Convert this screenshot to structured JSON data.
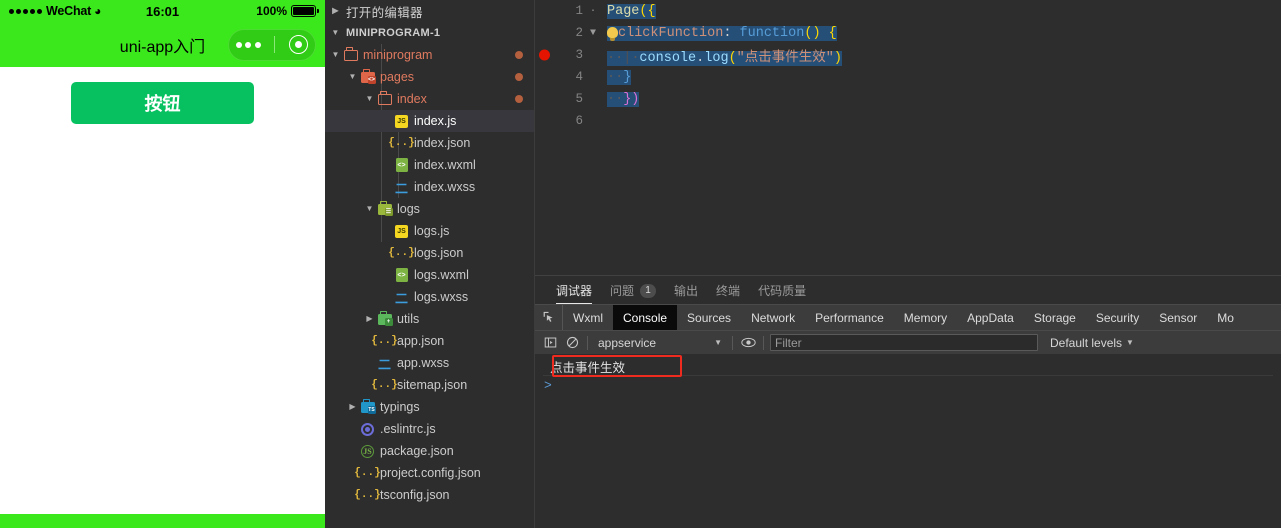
{
  "simulator": {
    "status_bar": {
      "carrier": "WeChat",
      "wifi_icon": "wifi-icon",
      "time": "16:01",
      "battery_percent": "100%",
      "battery_icon": "battery-full-icon"
    },
    "nav_title": "uni-app入门",
    "capsule": {
      "more_icon": "more-dots-icon",
      "target_icon": "target-circle-icon"
    },
    "button_label": "按钮",
    "colors": {
      "status_green": "#3ae81b",
      "button_green": "#07c160"
    }
  },
  "explorer": {
    "open_editors_label": "打开的编辑器",
    "project_label": "MINIPROGRAM-1",
    "items": [
      {
        "label": "miniprogram",
        "icon": "folder-icon",
        "depth": 1,
        "type": "folder",
        "expanded": true,
        "modified": true,
        "selected": false
      },
      {
        "label": "pages",
        "icon": "folder-pages-icon",
        "depth": 2,
        "type": "folder",
        "expanded": true,
        "modified": true,
        "selected": false
      },
      {
        "label": "index",
        "icon": "folder-icon",
        "depth": 3,
        "type": "folder",
        "expanded": true,
        "modified": true,
        "selected": false
      },
      {
        "label": "index.js",
        "icon": "js-file-icon",
        "depth": 4,
        "type": "file",
        "expanded": false,
        "modified": false,
        "selected": true
      },
      {
        "label": "index.json",
        "icon": "json-file-icon",
        "depth": 4,
        "type": "file",
        "expanded": false,
        "modified": false,
        "selected": false
      },
      {
        "label": "index.wxml",
        "icon": "wxml-file-icon",
        "depth": 4,
        "type": "file",
        "expanded": false,
        "modified": false,
        "selected": false
      },
      {
        "label": "index.wxss",
        "icon": "wxss-file-icon",
        "depth": 4,
        "type": "file",
        "expanded": false,
        "modified": false,
        "selected": false
      },
      {
        "label": "logs",
        "icon": "folder-logs-icon",
        "depth": 3,
        "type": "folder",
        "expanded": true,
        "modified": false,
        "selected": false
      },
      {
        "label": "logs.js",
        "icon": "js-file-icon",
        "depth": 4,
        "type": "file",
        "expanded": false,
        "modified": false,
        "selected": false
      },
      {
        "label": "logs.json",
        "icon": "json-file-icon",
        "depth": 4,
        "type": "file",
        "expanded": false,
        "modified": false,
        "selected": false
      },
      {
        "label": "logs.wxml",
        "icon": "wxml-file-icon",
        "depth": 4,
        "type": "file",
        "expanded": false,
        "modified": false,
        "selected": false
      },
      {
        "label": "logs.wxss",
        "icon": "wxss-file-icon",
        "depth": 4,
        "type": "file",
        "expanded": false,
        "modified": false,
        "selected": false
      },
      {
        "label": "utils",
        "icon": "folder-utils-icon",
        "depth": 3,
        "type": "folder",
        "expanded": false,
        "modified": false,
        "selected": false
      },
      {
        "label": "app.json",
        "icon": "json-file-icon",
        "depth": 3,
        "type": "file",
        "expanded": false,
        "modified": false,
        "selected": false
      },
      {
        "label": "app.wxss",
        "icon": "wxss-file-icon",
        "depth": 3,
        "type": "file",
        "expanded": false,
        "modified": false,
        "selected": false
      },
      {
        "label": "sitemap.json",
        "icon": "json-file-icon",
        "depth": 3,
        "type": "file",
        "expanded": false,
        "modified": false,
        "selected": false
      },
      {
        "label": "typings",
        "icon": "folder-ts-icon",
        "depth": 2,
        "type": "folder",
        "expanded": false,
        "modified": false,
        "selected": false
      },
      {
        "label": ".eslintrc.js",
        "icon": "eslint-file-icon",
        "depth": 2,
        "type": "file",
        "expanded": false,
        "modified": false,
        "selected": false
      },
      {
        "label": "package.json",
        "icon": "npm-file-icon",
        "depth": 2,
        "type": "file",
        "expanded": false,
        "modified": false,
        "selected": false
      },
      {
        "label": "project.config.json",
        "icon": "json-file-icon",
        "depth": 2,
        "type": "file",
        "expanded": false,
        "modified": false,
        "selected": false
      },
      {
        "label": "tsconfig.json",
        "icon": "json-file-icon",
        "depth": 2,
        "type": "file",
        "expanded": false,
        "modified": false,
        "selected": false
      }
    ]
  },
  "editor": {
    "breakpoint_line": 3,
    "lines": [
      {
        "num": "1",
        "fold": "",
        "text": "Page({"
      },
      {
        "num": "2",
        "fold": "chevron-down-icon",
        "text": "  clickFunction: function() {"
      },
      {
        "num": "3",
        "fold": "",
        "text": "    console.log(\"点击事件生效\")"
      },
      {
        "num": "4",
        "fold": "",
        "text": "  }"
      },
      {
        "num": "5",
        "fold": "",
        "text": "})"
      },
      {
        "num": "6",
        "fold": "",
        "text": ""
      }
    ],
    "tokens": {
      "page": "Page",
      "open_paren_brace": "({",
      "prop": "clickFunction",
      "colon": ": ",
      "kw_function": "function",
      "fn_parens": "() ",
      "brace_open": "{",
      "console": "console",
      "dot": ".",
      "log": "log",
      "paren_open": "(",
      "string": "\"点击事件生效\"",
      "paren_close": ")",
      "brace_close": "}",
      "end": "})"
    }
  },
  "panel": {
    "tabs": [
      {
        "label": "调试器",
        "active": true,
        "count": null
      },
      {
        "label": "问题",
        "active": false,
        "count": "1"
      },
      {
        "label": "输出",
        "active": false,
        "count": null
      },
      {
        "label": "终端",
        "active": false,
        "count": null
      },
      {
        "label": "代码质量",
        "active": false,
        "count": null
      }
    ]
  },
  "devtools": {
    "inspect_icon": "inspect-cursor-icon",
    "tabs": [
      {
        "label": "Wxml",
        "active": false
      },
      {
        "label": "Console",
        "active": true
      },
      {
        "label": "Sources",
        "active": false
      },
      {
        "label": "Network",
        "active": false
      },
      {
        "label": "Performance",
        "active": false
      },
      {
        "label": "Memory",
        "active": false
      },
      {
        "label": "AppData",
        "active": false
      },
      {
        "label": "Storage",
        "active": false
      },
      {
        "label": "Security",
        "active": false
      },
      {
        "label": "Sensor",
        "active": false
      },
      {
        "label": "Mo",
        "active": false
      }
    ],
    "toolbar": {
      "sidebar_icon": "show-console-sidebar-icon",
      "clear_icon": "clear-console-icon",
      "context": "appservice",
      "context_caret_icon": "chevron-down-icon",
      "eye_icon": "live-expression-eye-icon",
      "filter_placeholder": "Filter",
      "filter_value": "",
      "levels_label": "Default levels",
      "levels_caret_icon": "chevron-down-icon"
    },
    "console": {
      "messages": [
        {
          "text": "点击事件生效",
          "annotated": true
        }
      ],
      "prompt_icon": "console-prompt-arrow-icon"
    },
    "annotation_color": "#ef2a1f"
  }
}
